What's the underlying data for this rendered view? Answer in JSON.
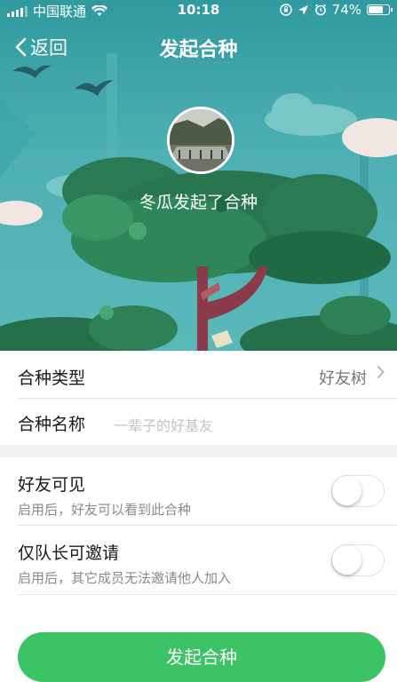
{
  "status_bar": {
    "carrier": "中国联通",
    "time": "10:18",
    "battery": "74%",
    "battery_level": 0.74
  },
  "nav": {
    "back_label": "返回",
    "title": "发起合种"
  },
  "hero": {
    "initiator_text": "冬瓜发起了合种"
  },
  "form": {
    "type": {
      "label": "合种类型",
      "value": "好友树"
    },
    "name": {
      "label": "合种名称",
      "placeholder": "一辈子的好基友"
    },
    "friends_visible": {
      "label": "好友可见",
      "desc": "启用后，好友可以看到此合种",
      "enabled": false
    },
    "captain_invite": {
      "label": "仅队长可邀请",
      "desc": "启用后，其它成员无法邀请他人加入",
      "enabled": false
    }
  },
  "submit_label": "发起合种",
  "colors": {
    "accent": "#3cc366",
    "hero_sky": "#4fb0b3",
    "tree": "#2e7d4f"
  }
}
